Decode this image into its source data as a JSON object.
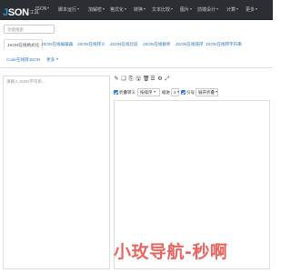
{
  "brand": {
    "logo": "JSON",
    "sub": "工具"
  },
  "nav": {
    "items": [
      "JSON",
      "脚本运行",
      "加解密",
      "格式化",
      "转换",
      "文本比较",
      "图片",
      "前端设计",
      "计算",
      "更多"
    ]
  },
  "search": {
    "placeholder": "功能搜索"
  },
  "tabs": [
    "JSON在线格式化",
    "JSON在线编辑器",
    "JSON在线转义",
    "JSON在线比较",
    "JSON在线解析",
    "JSON在线排序",
    "JSON在线转字符串",
    "Code在线转JSON",
    "更多"
  ],
  "input": {
    "placeholder": "请输入JSON字符串..."
  },
  "toolbar": {
    "icons": [
      "pencil-icon",
      "document-icon",
      "copy-icon",
      "save-icon",
      "trash-icon",
      "list-icon",
      "gear-icon",
      "expand-icon"
    ],
    "glyphs": [
      "✎",
      "❏",
      "⎘",
      "🖫",
      "🗑",
      "☰",
      "⚙",
      "⤢"
    ]
  },
  "options": {
    "fold_label": "折叠转义",
    "fold_checked": true,
    "sort_select": "按排序",
    "indent_label": "缩进",
    "indent_value": "2",
    "quote_label": "引号",
    "quote_checked": true,
    "output_select": "展开折叠"
  },
  "watermark": {
    "text": "小玫导航-秒啊"
  },
  "colors": {
    "navbar": "#2b2f33",
    "link": "#337ab7",
    "accent": "#2a7ae2",
    "watermark": "#e8554e"
  }
}
